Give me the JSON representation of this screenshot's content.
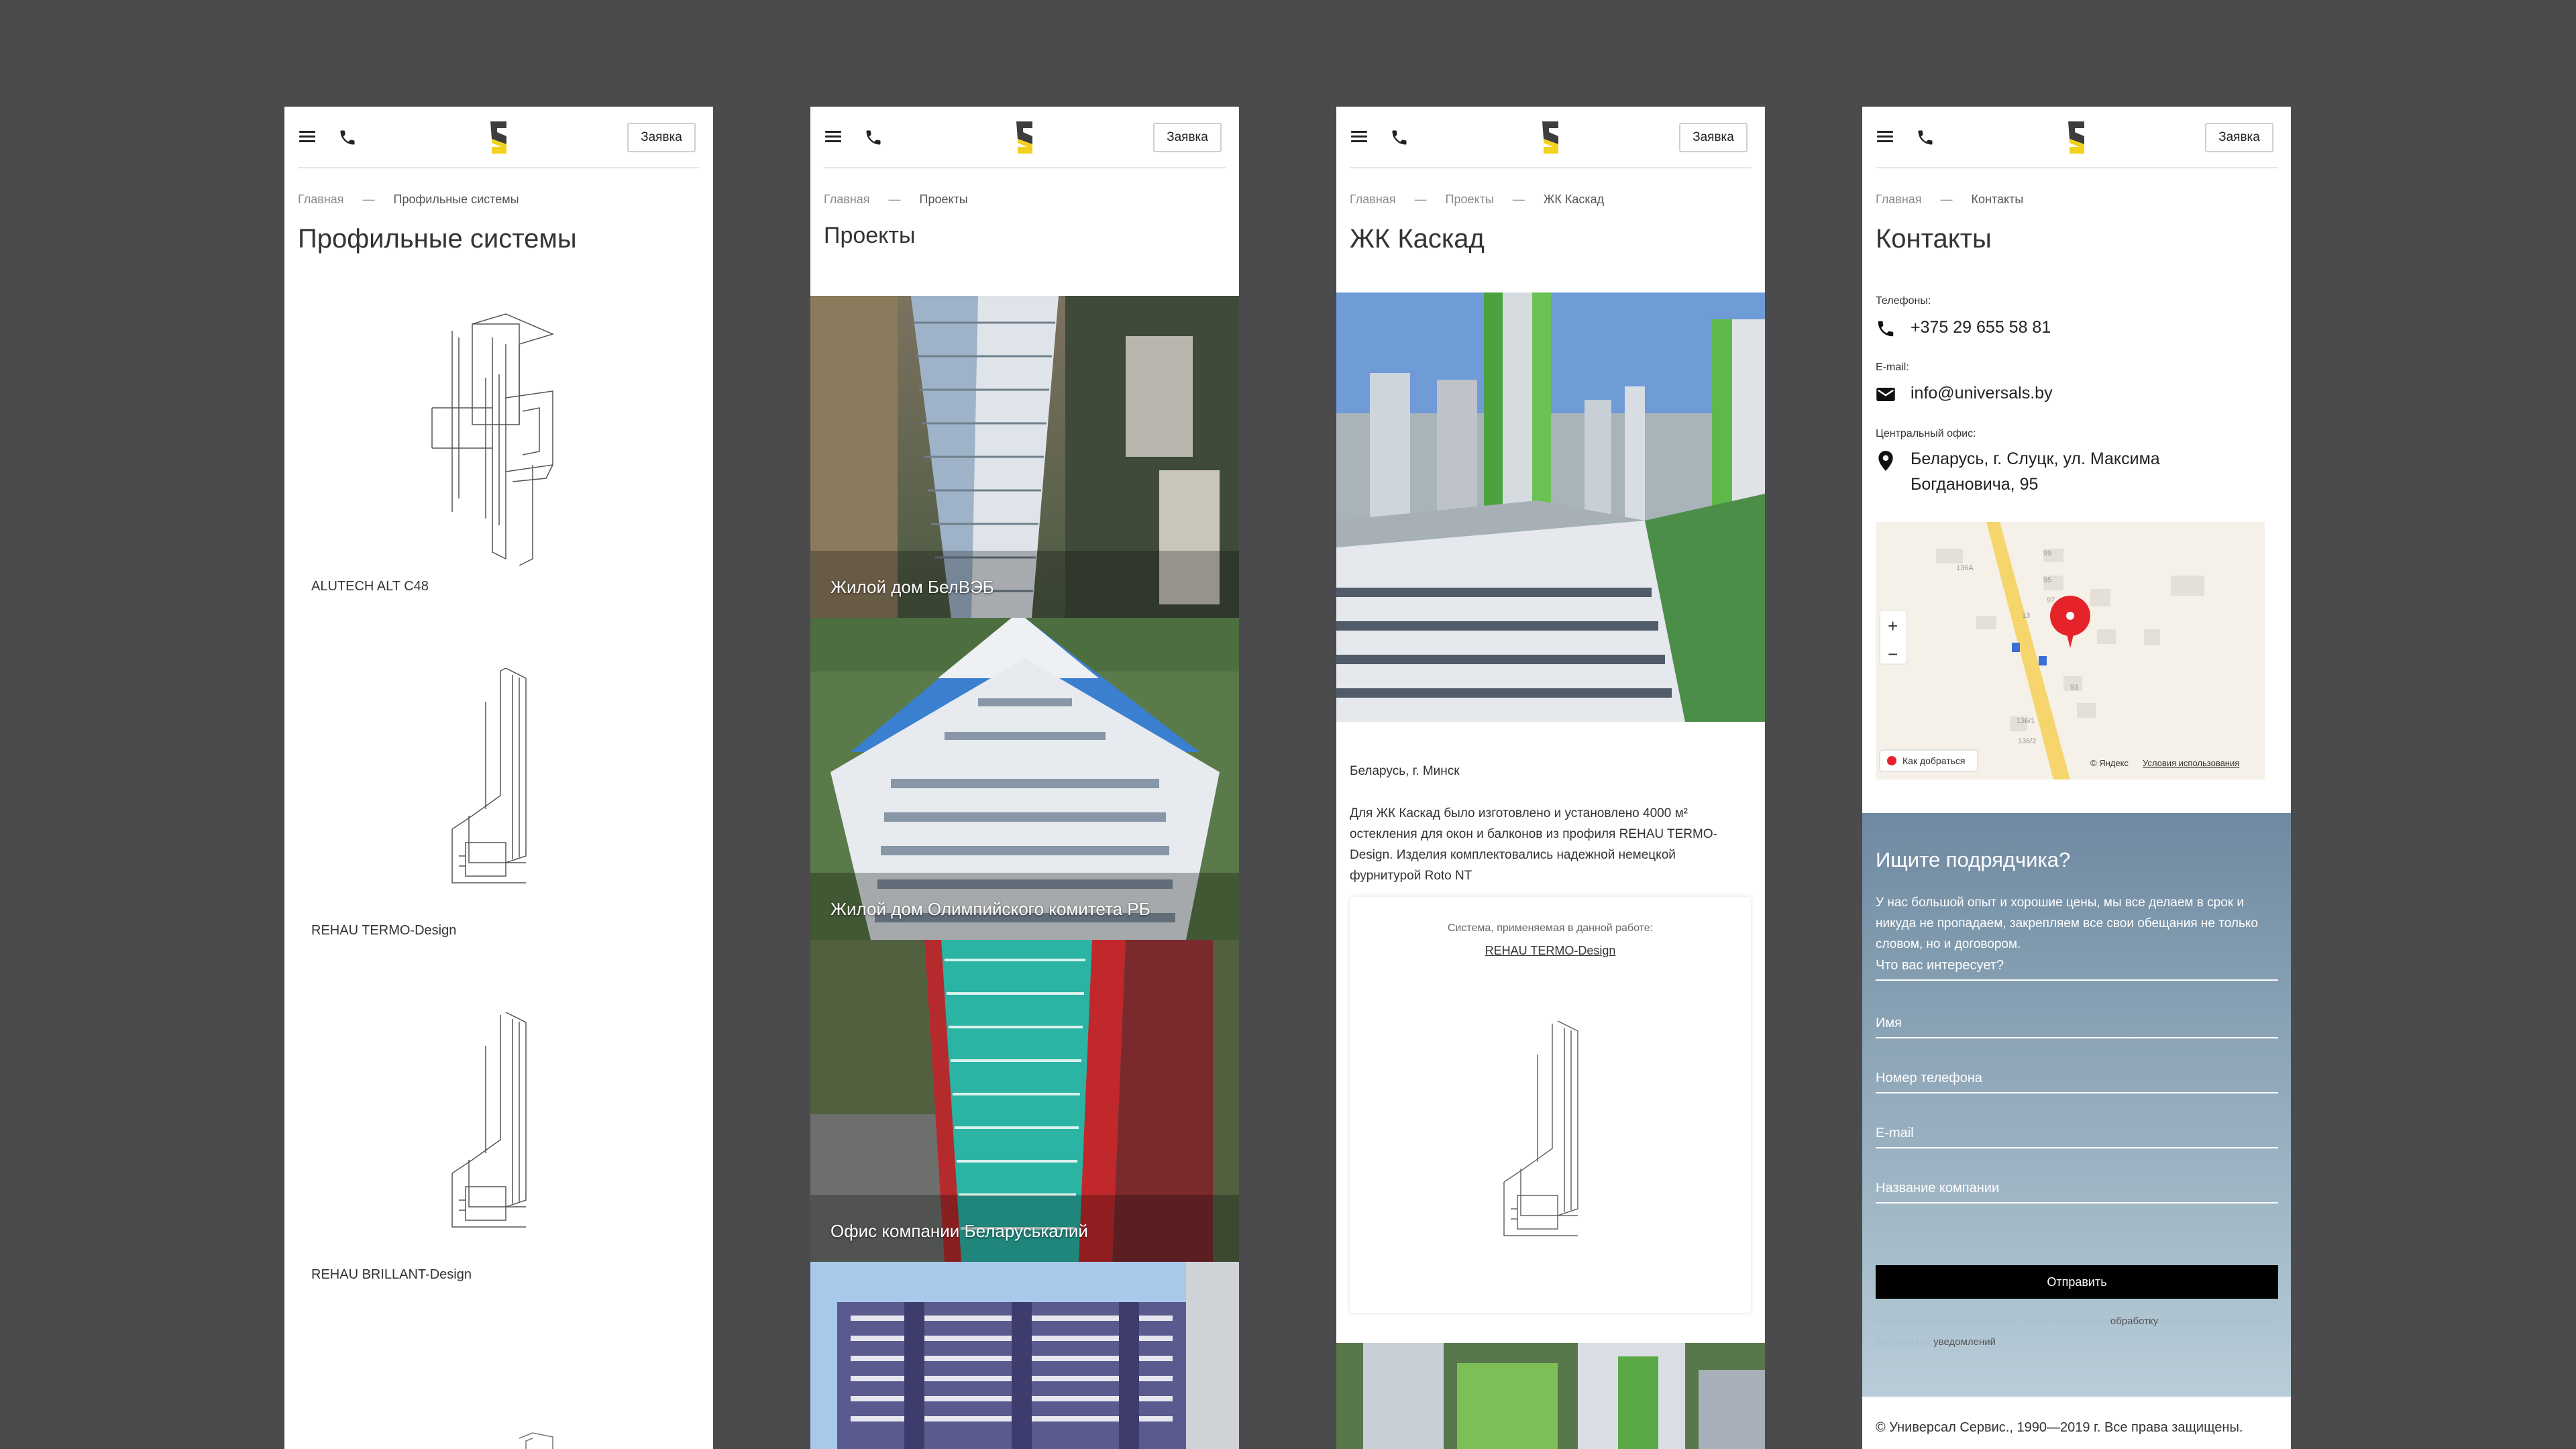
{
  "header": {
    "request_label": "Заявка"
  },
  "panel1": {
    "crumb_home": "Главная",
    "crumb_sep": "—",
    "crumb_current": "Профильные системы",
    "title": "Профильные системы",
    "products": [
      {
        "name": "ALUTECH ALT C48"
      },
      {
        "name": "REHAU TERMO-Design"
      },
      {
        "name": "REHAU BRILLANT-Design"
      }
    ]
  },
  "panel2": {
    "crumb_home": "Главная",
    "crumb_sep": "—",
    "crumb_current": "Проекты",
    "title": "Проекты",
    "projects": [
      {
        "name": "Жилой дом БелВЭБ"
      },
      {
        "name": "Жилой дом Олимпийского комитета РБ"
      },
      {
        "name": "Офис компании Беларуськалий"
      }
    ]
  },
  "panel3": {
    "crumb_home": "Главная",
    "crumb_sep": "—",
    "crumb_mid": "Проекты",
    "crumb_current": "ЖК Каскад",
    "title": "ЖК Каскад",
    "location": "Беларусь, г. Минск",
    "description": "Для ЖК Каскад было изготовлено и установлено 4000 м² остекления для окон и балконов из профиля REHAU TERMO-Design. Изделия комплектовались надежной немецкой фурнитурой Roto NT",
    "system_label": "Система, применяемая в данной работе:",
    "system_link": "REHAU TERMO-Design"
  },
  "panel4": {
    "crumb_home": "Главная",
    "crumb_sep": "—",
    "crumb_current": "Контакты",
    "title": "Контакты",
    "phones_label": "Телефоны:",
    "phone": "+375 29 655 58 81",
    "email_label": "E-mail:",
    "email": "info@universals.by",
    "office_label": "Центральный офис:",
    "address_line1": "Беларусь, г. Слуцк, ул. Максима",
    "address_line2": "Богдановича, 95",
    "map": {
      "zoom_in": "+",
      "zoom_out": "−",
      "route": "Как добраться",
      "yandex": "© Яндекс",
      "terms": "Условия использования",
      "labels": [
        "136A",
        "13",
        "95",
        "97",
        "99",
        "136/1",
        "136/2",
        "93"
      ]
    },
    "form": {
      "title": "Ищите подрядчика?",
      "text": "У нас большой опыт и хорошие цены, мы все делаем в срок и никуда не пропадаем, закрепляем все свои обещания не только словом, но и договором.",
      "f_interest": "Что вас интересует?",
      "f_name": "Имя",
      "f_phone": "Номер телефона",
      "f_email": "E-mail",
      "f_company": "Название компании",
      "submit": "Отправить",
      "consent_a": "Нажимая кнопку «Отправить», я даю согласие на",
      "consent_link1": "обработку",
      "consent_b": "персональных данных в которую мы",
      "consent_link2": "уведомлений"
    },
    "footer": "© Универсал Сервис., 1990—2019 г. Все права защищены."
  },
  "colors": {
    "background": "#4b4a4c",
    "logo_yellow": "#f2d21f",
    "logo_dark": "#3d3d3d",
    "pin": "#e6232a"
  }
}
